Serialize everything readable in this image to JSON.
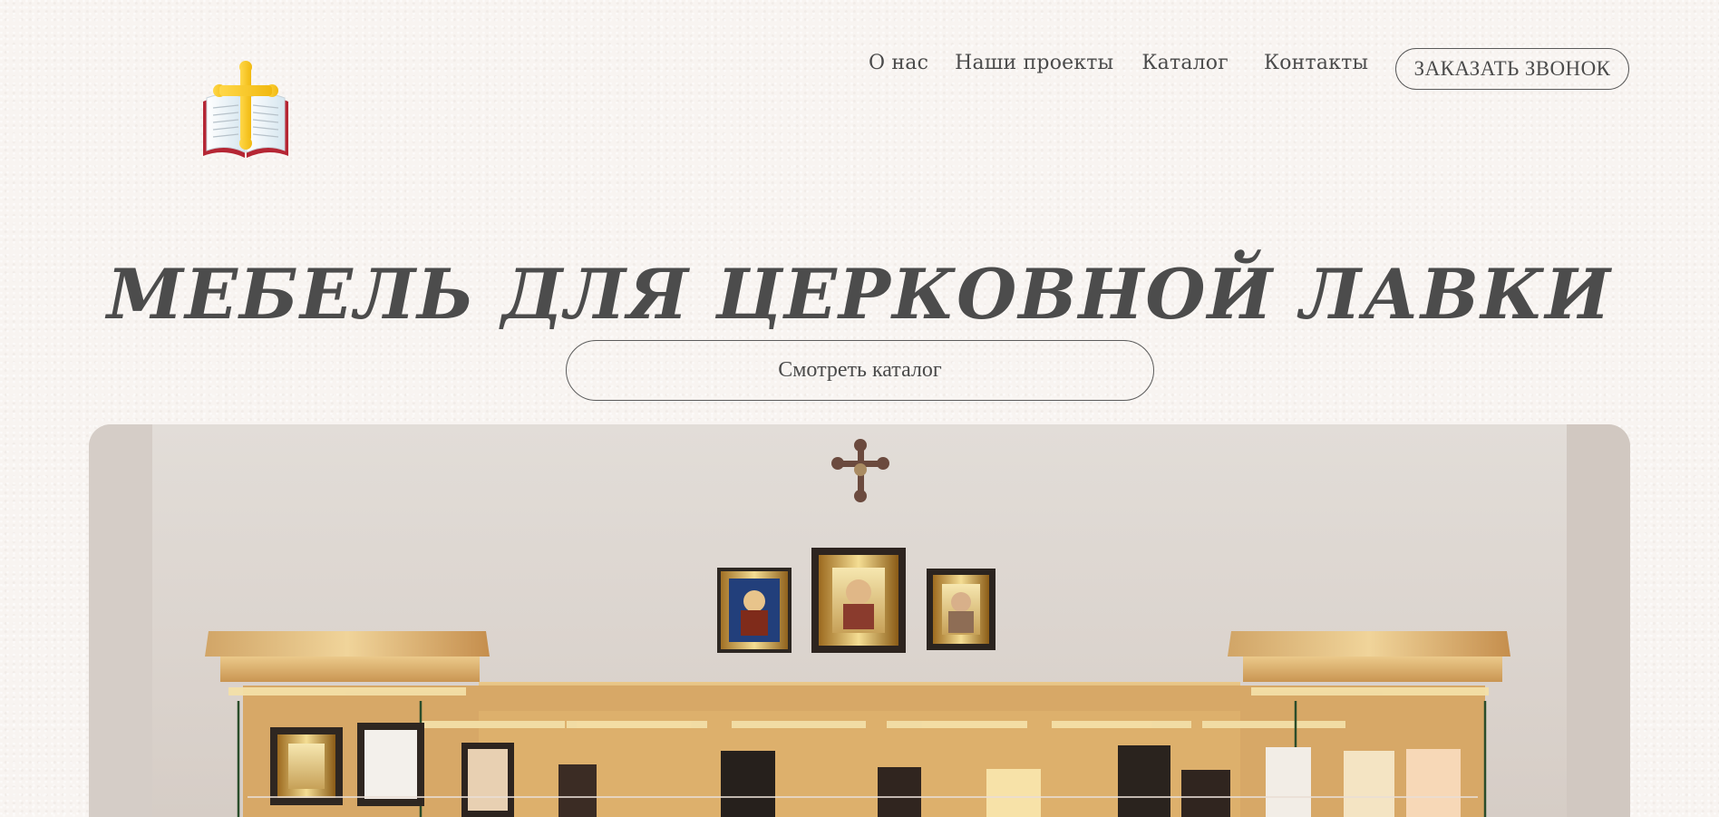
{
  "header": {
    "logo_icon": "bible-with-cross-icon",
    "nav": [
      {
        "label": "О нас"
      },
      {
        "label": "Наши проекты"
      },
      {
        "label": "Каталог"
      },
      {
        "label": "Контакты"
      }
    ],
    "call_button": "ЗАКАЗАТЬ ЗВОНОК"
  },
  "hero": {
    "title": "МЕБЕЛЬ ДЛЯ ЦЕРКОВНОЙ ЛАВКИ",
    "catalog_button": "Смотреть каталог",
    "image_subject": "church-shop-furniture-with-icons"
  },
  "colors": {
    "background": "#f8f4f1",
    "text": "#4a4a4a",
    "border": "#5c5c5c",
    "wood": "#d7b27a",
    "gold": "#f0c419",
    "bible_red": "#b51f2b"
  }
}
